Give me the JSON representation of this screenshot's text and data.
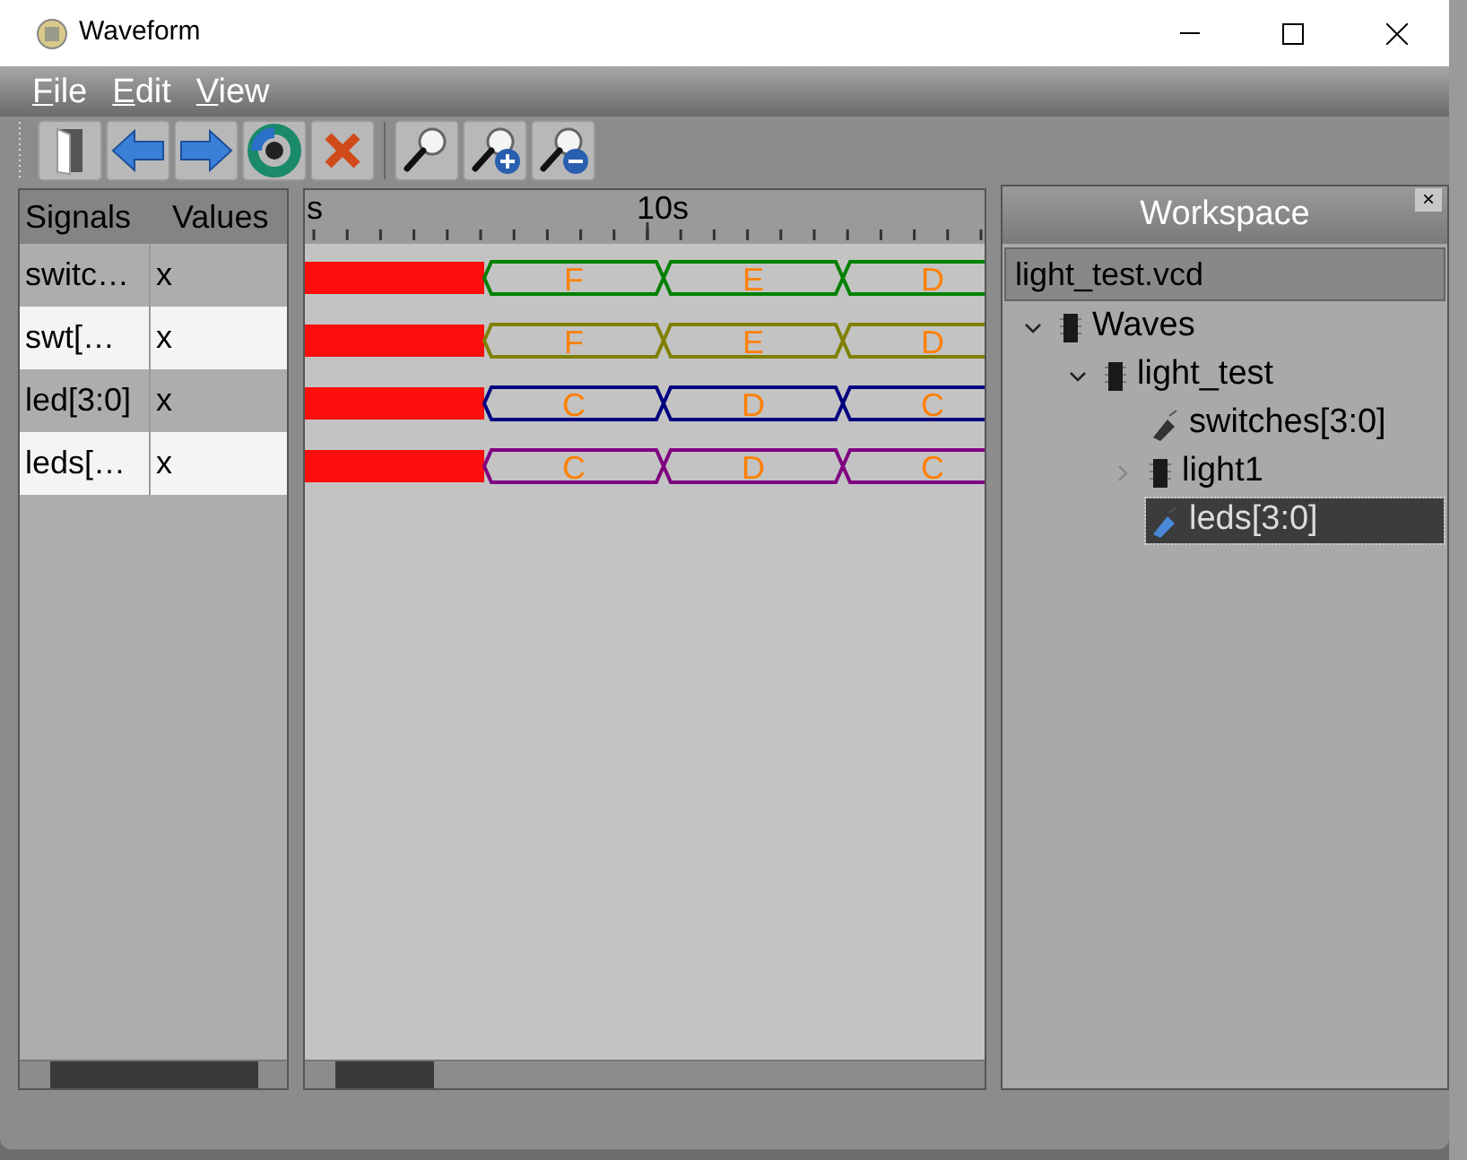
{
  "window": {
    "title": "Waveform"
  },
  "menu": [
    {
      "label": "File",
      "mnemonic": true
    },
    {
      "label": "Edit",
      "mnemonic": true
    },
    {
      "label": "View",
      "mnemonic": true
    }
  ],
  "toolbar": [
    {
      "kind": "door"
    },
    {
      "kind": "back"
    },
    {
      "kind": "forward"
    },
    {
      "kind": "reload"
    },
    {
      "kind": "delete"
    },
    {
      "kind": "separator"
    },
    {
      "kind": "zoom"
    },
    {
      "kind": "zoom-in"
    },
    {
      "kind": "zoom-out"
    }
  ],
  "signals": {
    "columns": [
      "Signals",
      "Values"
    ],
    "rows": [
      {
        "signal": "switc…",
        "value": "x"
      },
      {
        "signal": "swt[…",
        "value": "x"
      },
      {
        "signal": "led[3:0]",
        "value": "x"
      },
      {
        "signal": "leds[…",
        "value": "x"
      }
    ]
  },
  "timeline": {
    "ruler": [
      "s",
      "10s"
    ],
    "waves": [
      {
        "color": "#008000",
        "segments": [
          "F",
          "E",
          "D"
        ]
      },
      {
        "color": "#808000",
        "segments": [
          "F",
          "E",
          "D"
        ]
      },
      {
        "color": "#000080",
        "segments": [
          "C",
          "D",
          "C"
        ]
      },
      {
        "color": "#800080",
        "segments": [
          "C",
          "D",
          "C"
        ]
      }
    ]
  },
  "workspace": {
    "title": "Workspace",
    "close": "×",
    "file": "light_test.vcd",
    "tree": [
      {
        "label": "Waves",
        "kind": "module",
        "expanded": true,
        "selected": false,
        "children": [
          {
            "label": "light_test",
            "kind": "module",
            "expanded": true,
            "selected": false,
            "children": [
              {
                "label": "switches[3:0]",
                "kind": "signal",
                "selected": false
              },
              {
                "label": "light1",
                "kind": "module",
                "expanded": false,
                "selected": false
              },
              {
                "label": "leds[3:0]",
                "kind": "signal",
                "selected": true
              }
            ]
          }
        ]
      }
    ]
  }
}
